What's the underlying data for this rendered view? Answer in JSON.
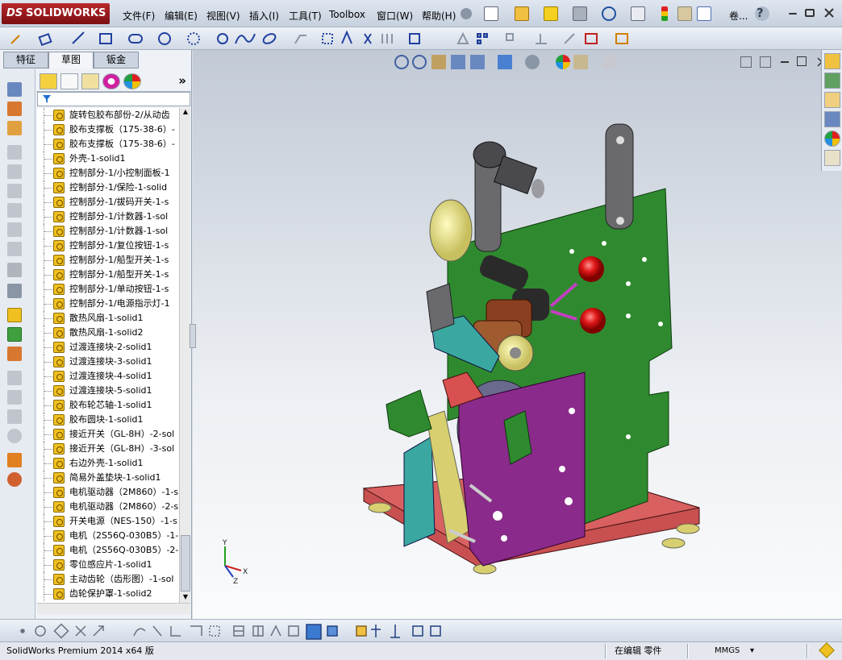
{
  "app": {
    "logo_prefix": "DS",
    "logo_text": "SOLIDWORKS"
  },
  "menu": [
    {
      "id": "file",
      "label": "文件(F)"
    },
    {
      "id": "edit",
      "label": "编辑(E)"
    },
    {
      "id": "view",
      "label": "视图(V)"
    },
    {
      "id": "insert",
      "label": "插入(I)"
    },
    {
      "id": "tools",
      "label": "工具(T)"
    },
    {
      "id": "toolbox",
      "label": "Toolbox"
    },
    {
      "id": "window",
      "label": "窗口(W)"
    },
    {
      "id": "help",
      "label": "帮助(H)"
    }
  ],
  "toolbar_search_label": "卷...",
  "help_glyph": "?",
  "tabs": [
    {
      "label": "特征",
      "active": false
    },
    {
      "label": "草图",
      "active": true
    },
    {
      "label": "钣金",
      "active": false
    }
  ],
  "expand_glyph": "»",
  "tree_items": [
    "旋转包胶布部份-2/从动齿",
    "胶布支撑板（175-38-6）-",
    "胶布支撑板（175-38-6）-",
    "外壳-1-solid1",
    "控制部分-1/小控制面板-1",
    "控制部分-1/保险-1-solid",
    "控制部分-1/拔码开关-1-s",
    "控制部分-1/计数器-1-sol",
    "控制部分-1/计数器-1-sol",
    "控制部分-1/复位按钮-1-s",
    "控制部分-1/船型开关-1-s",
    "控制部分-1/船型开关-1-s",
    "控制部分-1/单动按钮-1-s",
    "控制部分-1/电源指示灯-1",
    "散热风扇-1-solid1",
    "散热风扇-1-solid2",
    "过渡连接块-2-solid1",
    "过渡连接块-3-solid1",
    "过渡连接块-4-solid1",
    "过渡连接块-5-solid1",
    "胶布轮芯轴-1-solid1",
    "胶布圆块-1-solid1",
    "接近开关（GL-8H）-2-sol",
    "接近开关（GL-8H）-3-sol",
    "右边外壳-1-solid1",
    "简易外盖垫块-1-solid1",
    "电机驱动器（2M860）-1-s",
    "电机驱动器（2M860）-2-s",
    "开关电源（NES-150）-1-s",
    "电机（2S56Q-030B5）-1-s",
    "电机（2S56Q-030B5）-2-s",
    "零位感应片-1-solid1",
    "主动齿轮（齿形图）-1-sol",
    "齿轮保护罩-1-solid2"
  ],
  "status": {
    "product": "SolidWorks Premium 2014 x64 版",
    "mode": "在编辑 零件",
    "units": "MMGS",
    "units_caret": "▾"
  },
  "triad": {
    "x": "X",
    "y": "Y",
    "z": "Z"
  },
  "colors": {
    "green_plate": "#2f8a2f",
    "purple_panel": "#8a2a8a",
    "base": "#c85050",
    "cyan_part": "#3aa8a0",
    "yellow_roller": "#d8d070",
    "red_knob": "#e01818",
    "gray_arm": "#6a6a6e"
  }
}
